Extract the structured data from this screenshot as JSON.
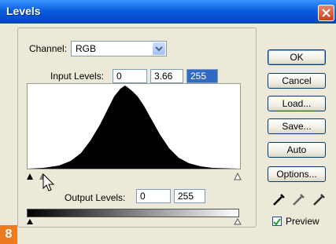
{
  "window": {
    "title": "Levels"
  },
  "channel": {
    "label": "Channel:",
    "value": "RGB"
  },
  "input_levels": {
    "label": "Input Levels:",
    "black": "0",
    "gamma": "3.66",
    "white": "255"
  },
  "output_levels": {
    "label": "Output Levels:",
    "black": "0",
    "white": "255"
  },
  "buttons": {
    "ok": "OK",
    "cancel": "Cancel",
    "load": "Load...",
    "save": "Save...",
    "auto": "Auto",
    "options": "Options..."
  },
  "preview": {
    "label": "Preview",
    "checked": true
  },
  "badge": {
    "number": "8"
  },
  "colors": {
    "title_bar": "#0A5FE0",
    "dialog_bg": "#ECE9D8",
    "selection": "#316AC5",
    "badge": "#EE7A1E"
  }
}
